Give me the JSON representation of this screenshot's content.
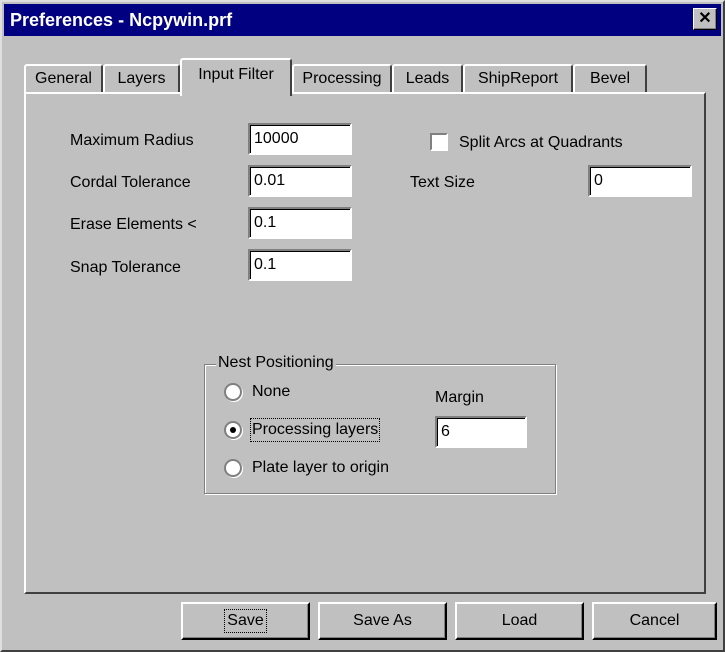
{
  "window": {
    "title": "Preferences - Ncpywin.prf",
    "close_glyph": "✕"
  },
  "tabs": [
    {
      "label": "General"
    },
    {
      "label": "Layers"
    },
    {
      "label": "Input Filter"
    },
    {
      "label": "Processing"
    },
    {
      "label": "Leads"
    },
    {
      "label": "ShipReport"
    },
    {
      "label": "Bevel"
    }
  ],
  "active_tab": "Input Filter",
  "input_filter": {
    "maximum_radius": {
      "label": "Maximum Radius",
      "value": "10000"
    },
    "cordal_tolerance": {
      "label": "Cordal Tolerance",
      "value": "0.01"
    },
    "erase_elements": {
      "label": "Erase Elements <",
      "value": "0.1"
    },
    "snap_tolerance": {
      "label": "Snap Tolerance",
      "value": "0.1"
    },
    "split_arcs": {
      "label": "Split Arcs at Quadrants",
      "checked": false
    },
    "text_size": {
      "label": "Text Size",
      "value": "0"
    }
  },
  "nest_positioning": {
    "title": "Nest Positioning",
    "options": [
      {
        "label": "None",
        "selected": false
      },
      {
        "label": "Processing layers",
        "selected": true
      },
      {
        "label": "Plate layer to origin",
        "selected": false
      }
    ],
    "margin": {
      "label": "Margin",
      "value": "6"
    }
  },
  "buttons": {
    "save": "Save",
    "save_as": "Save As",
    "load": "Load",
    "cancel": "Cancel"
  },
  "colors": {
    "titlebar": "#000080",
    "face": "#c0c0c0"
  }
}
